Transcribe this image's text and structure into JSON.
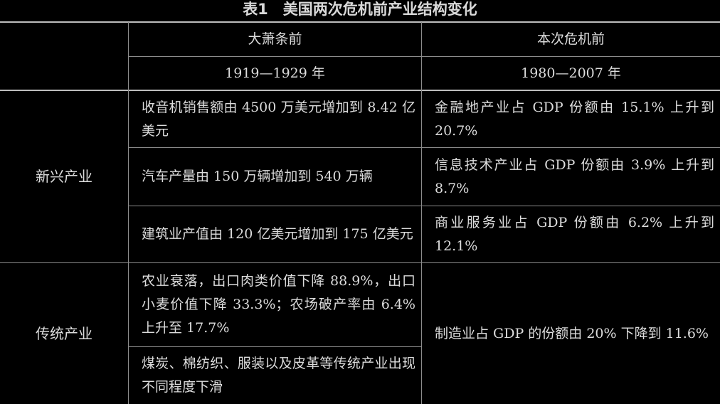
{
  "table": {
    "title": "表1　美国两次危机前产业结构变化",
    "header": {
      "col1": "大萧条前",
      "col2": "本次危机前",
      "period1": "1919—1929 年",
      "period2": "1980—2007 年"
    },
    "groups": [
      {
        "label": "新兴产业",
        "rows": [
          {
            "before": "收音机销售额由 4500 万美元增加到 8.42 亿美元",
            "recent": "金融地产业占 GDP 份额由 15.1% 上升到 20.7%"
          },
          {
            "before": "汽车产量由 150 万辆增加到 540 万辆",
            "recent": "信息技术产业占 GDP 份额由 3.9% 上升到 8.7%"
          },
          {
            "before": "建筑业产值由 120 亿美元增加到 175 亿美元",
            "recent": "商业服务业占 GDP 份额由 6.2% 上升到 12.1%"
          }
        ]
      },
      {
        "label": "传统产业",
        "rows": [
          {
            "before": "农业衰落，出口肉类价值下降 88.9%，出口小麦价值下降 33.3%；农场破产率由 6.4% 上升至 17.7%"
          },
          {
            "before": "煤炭、棉纺织、服装以及皮革等传统产业出现不同程度下滑"
          }
        ],
        "recent": "制造业占 GDP 的份额由 20% 下降到 11.6%"
      }
    ]
  }
}
